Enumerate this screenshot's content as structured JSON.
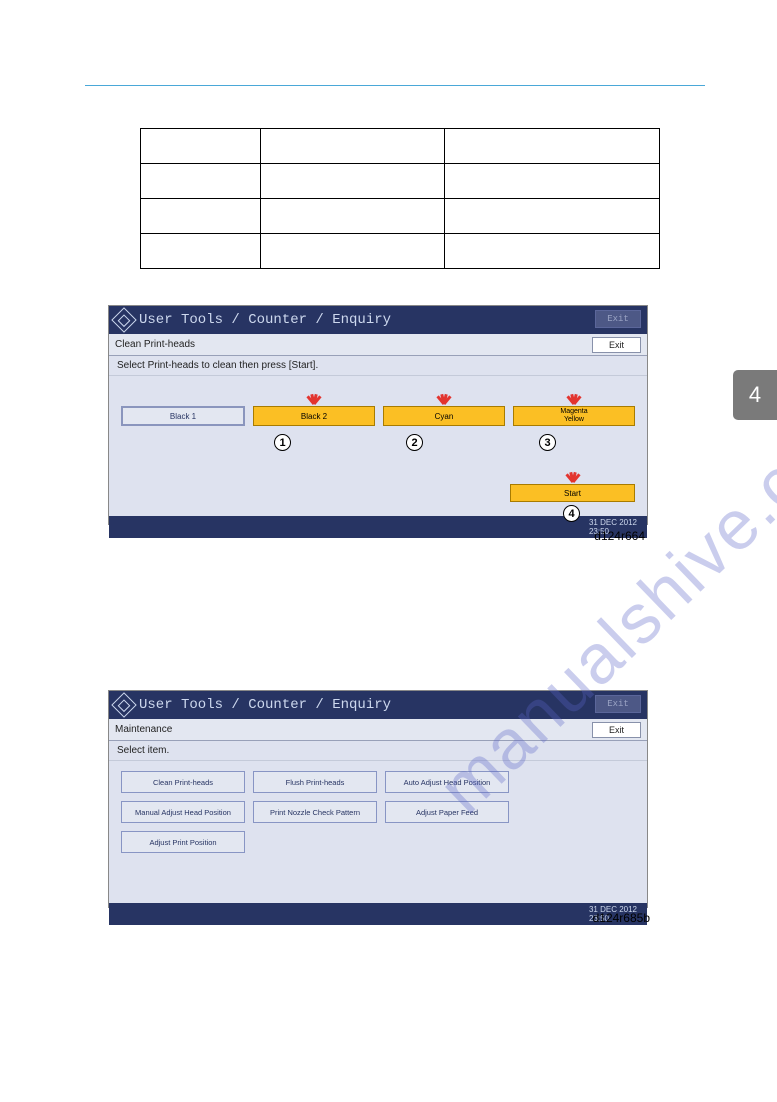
{
  "side_tab": "4",
  "watermark": "manualshive.com",
  "captions": {
    "shot1": "d124r664",
    "shot2": "d124r685b"
  },
  "shot1": {
    "title": "User Tools / Counter / Enquiry",
    "header_exit": "Exit",
    "subbar_label": "Clean Print-heads",
    "subbar_exit": "Exit",
    "instruction": "Select Print-heads to clean then press [Start].",
    "heads": [
      "Black 1",
      "Black 2",
      "Cyan",
      "Magenta\nYellow"
    ],
    "start": "Start",
    "callouts": [
      "1",
      "2",
      "3",
      "4"
    ],
    "footer_date": "31 DEC 2012",
    "footer_time": "23:50"
  },
  "shot2": {
    "title": "User Tools / Counter / Enquiry",
    "header_exit": "Exit",
    "subbar_label": "Maintenance",
    "subbar_exit": "Exit",
    "instruction": "Select item.",
    "items": [
      "Clean Print-heads",
      "Flush Print-heads",
      "Auto Adjust Head Position",
      "Manual Adjust Head Position",
      "Print Nozzle Check Pattern",
      "Adjust Paper Feed",
      "Adjust Print Position"
    ],
    "footer_date": "31 DEC 2012",
    "footer_time": "23:50"
  }
}
